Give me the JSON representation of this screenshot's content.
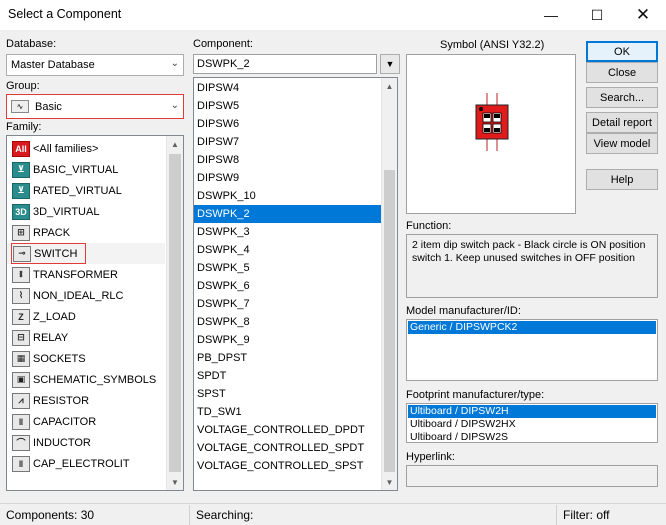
{
  "window": {
    "title": "Select a Component",
    "minimize_icon": "minimize-icon",
    "maximize_icon": "maximize-icon",
    "close_icon": "close-icon"
  },
  "database": {
    "label": "Database:",
    "value": "Master Database"
  },
  "group": {
    "label": "Group:",
    "value": "Basic"
  },
  "family": {
    "label": "Family:",
    "items": [
      {
        "label": "<All families>",
        "icon": "all-families-icon",
        "glyph": "All"
      },
      {
        "label": "BASIC_VIRTUAL",
        "icon": "basic-virtual-icon",
        "glyph": "⊻"
      },
      {
        "label": "RATED_VIRTUAL",
        "icon": "rated-virtual-icon",
        "glyph": "⊻"
      },
      {
        "label": "3D_VIRTUAL",
        "icon": "3d-virtual-icon",
        "glyph": "3D"
      },
      {
        "label": "RPACK",
        "icon": "rpack-icon",
        "glyph": "⊞"
      },
      {
        "label": "SWITCH",
        "icon": "switch-icon",
        "glyph": "⊸"
      },
      {
        "label": "TRANSFORMER",
        "icon": "transformer-icon",
        "glyph": "⧛"
      },
      {
        "label": "NON_IDEAL_RLC",
        "icon": "non-ideal-rlc-icon",
        "glyph": "⌇"
      },
      {
        "label": "Z_LOAD",
        "icon": "z-load-icon",
        "glyph": "Z"
      },
      {
        "label": "RELAY",
        "icon": "relay-icon",
        "glyph": "⊟"
      },
      {
        "label": "SOCKETS",
        "icon": "sockets-icon",
        "glyph": "▦"
      },
      {
        "label": "SCHEMATIC_SYMBOLS",
        "icon": "schematic-symbols-icon",
        "glyph": "▣"
      },
      {
        "label": "RESISTOR",
        "icon": "resistor-icon",
        "glyph": "⩘"
      },
      {
        "label": "CAPACITOR",
        "icon": "capacitor-icon",
        "glyph": "‖"
      },
      {
        "label": "INDUCTOR",
        "icon": "inductor-icon",
        "glyph": "⌒"
      },
      {
        "label": "CAP_ELECTROLIT",
        "icon": "cap-electrolit-icon",
        "glyph": "‖"
      }
    ]
  },
  "component": {
    "label": "Component:",
    "search_value": "DSWPK_2",
    "filter_icon": "filter-icon",
    "items": [
      "DIPSW4",
      "DIPSW5",
      "DIPSW6",
      "DIPSW7",
      "DIPSW8",
      "DIPSW9",
      "DSWPK_10",
      "DSWPK_2",
      "DSWPK_3",
      "DSWPK_4",
      "DSWPK_5",
      "DSWPK_6",
      "DSWPK_7",
      "DSWPK_8",
      "DSWPK_9",
      "PB_DPST",
      "SPDT",
      "SPST",
      "TD_SW1",
      "VOLTAGE_CONTROLLED_DPDT",
      "VOLTAGE_CONTROLLED_SPDT",
      "VOLTAGE_CONTROLLED_SPST"
    ],
    "selected": "DSWPK_2"
  },
  "symbol": {
    "label": "Symbol (ANSI Y32.2)"
  },
  "buttons": {
    "ok": "OK",
    "close": "Close",
    "search": "Search...",
    "detail_report": "Detail report",
    "view_model": "View model",
    "help": "Help"
  },
  "function": {
    "label": "Function:",
    "text": "2 item dip switch pack - Black circle is ON position switch 1. Keep unused switches in OFF position"
  },
  "model": {
    "label": "Model manufacturer/ID:",
    "items": [
      "Generic / DIPSWPCK2"
    ]
  },
  "footprint": {
    "label": "Footprint manufacturer/type:",
    "items": [
      "Ultiboard / DIPSW2H",
      "Ultiboard / DIPSW2HX",
      "Ultiboard / DIPSW2S"
    ]
  },
  "hyperlink": {
    "label": "Hyperlink:",
    "value": ""
  },
  "status": {
    "components": "Components: 30",
    "searching": "Searching:",
    "filter": "Filter: off"
  },
  "colors": {
    "selection": "#0078d7",
    "highlight_outline": "#e23b3b",
    "symbol_body": "#e01b1b"
  }
}
